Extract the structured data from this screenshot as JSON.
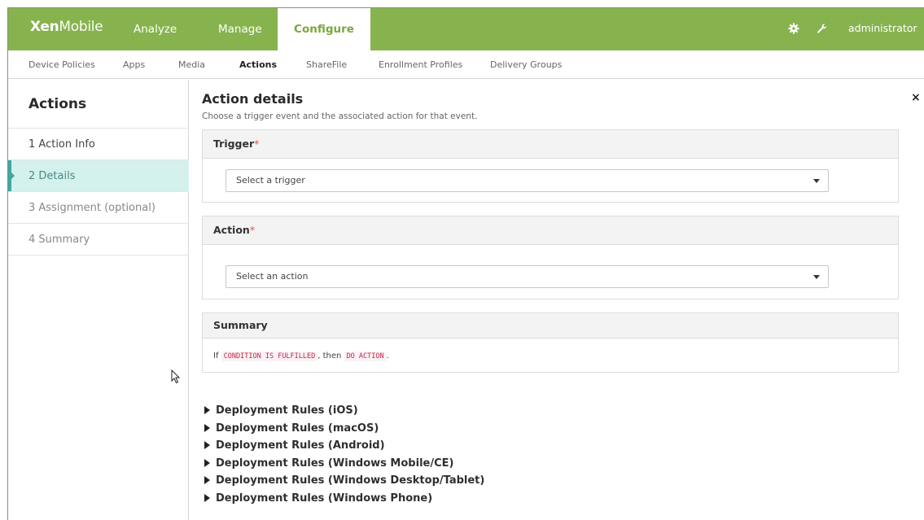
{
  "brand": {
    "bold": "Xen",
    "light": "Mobile"
  },
  "topnav": {
    "analyze": "Analyze",
    "manage": "Manage",
    "configure": "Configure",
    "user": "administrator"
  },
  "subnav": {
    "items": [
      "Device Policies",
      "Apps",
      "Media",
      "Actions",
      "ShareFile",
      "Enrollment Profiles",
      "Delivery Groups"
    ],
    "active": "Actions"
  },
  "sidebar": {
    "title": "Actions",
    "steps": [
      "1  Action Info",
      "2  Details",
      "3  Assignment (optional)",
      "4  Summary"
    ]
  },
  "main": {
    "title": "Action details",
    "subtitle": "Choose a trigger event and the associated action for that event.",
    "close": "×",
    "trigger": {
      "label": "Trigger",
      "required": "*",
      "placeholder": "Select a trigger"
    },
    "action": {
      "label": "Action",
      "required": "*",
      "placeholder": "Select an action"
    },
    "summary": {
      "label": "Summary",
      "prefix": "If",
      "condition": "CONDITION IS FULFILLED",
      "middle": ", then",
      "do_action": "DO ACTION",
      "suffix": "."
    },
    "rules": [
      "Deployment Rules (iOS)",
      "Deployment Rules (macOS)",
      "Deployment Rules (Android)",
      "Deployment Rules (Windows Mobile/CE)",
      "Deployment Rules (Windows Desktop/Tablet)",
      "Deployment Rules (Windows Phone)"
    ]
  },
  "icons": {
    "settings": "gear-icon",
    "tools": "wrench-icon",
    "dropdown": "chevron-down-icon",
    "expand": "triangle-right-icon"
  },
  "colors": {
    "brand_green": "#87b34e",
    "active_step": "#d4f1ee",
    "required": "#d9534f"
  }
}
